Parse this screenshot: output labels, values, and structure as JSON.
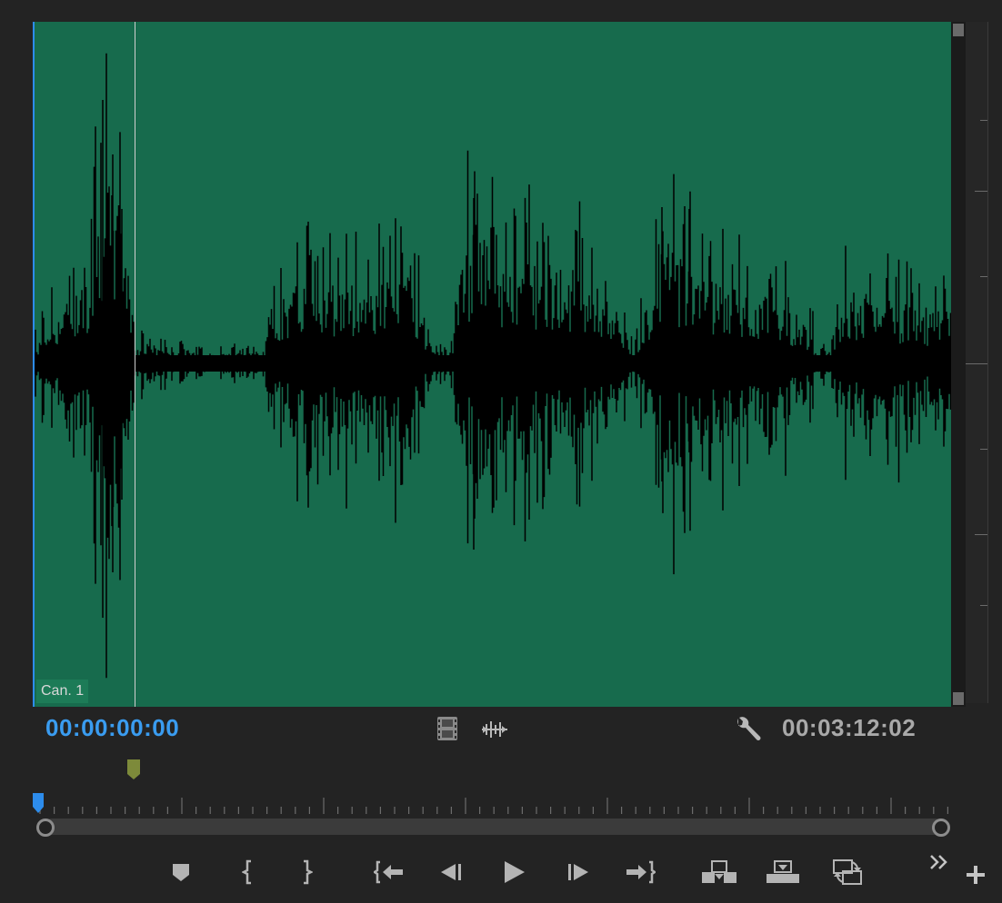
{
  "monitor": {
    "channel_label": "Can. 1",
    "timecode_current": "00:00:00:00",
    "timecode_duration": "00:03:12:02"
  },
  "icons": {
    "drag_video": "film-strip-icon",
    "drag_audio": "audio-waveform-icon",
    "settings": "wrench-icon",
    "add_marker": "marker-icon",
    "mark_in": "mark-in-icon",
    "mark_out": "mark-out-icon",
    "go_to_in": "go-to-in-icon",
    "step_back": "step-back-icon",
    "play": "play-icon",
    "step_forward": "step-forward-icon",
    "go_to_out": "go-to-out-icon",
    "insert": "insert-icon",
    "overwrite": "overwrite-icon",
    "export_frame": "export-frame-icon",
    "more": "more-controls-icon",
    "add": "button-editor-icon"
  },
  "colors": {
    "waveform_background": "#176b4d",
    "waveform": "#000000",
    "timecode_current": "#3a9cf0",
    "timecode_duration": "#a9a9a9",
    "marker": "#7d8a3a",
    "playhead": "#2d8ceb"
  }
}
